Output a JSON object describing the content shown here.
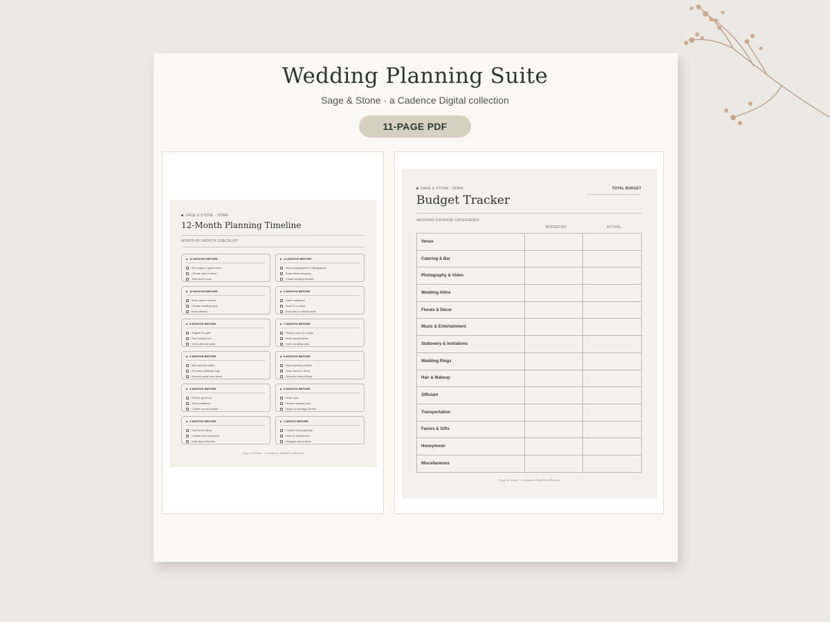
{
  "header": {
    "title": "Wedding Planning Suite",
    "subtitle": "Sage & Stone · a Cadence Digital collection",
    "badge": "11-PAGE PDF"
  },
  "timeline_page": {
    "breadcrumb": "SAGE & STONE  ·  HOME",
    "title": "12-Month Planning Timeline",
    "section_label": "MONTH-BY-MONTH CHECKLIST",
    "months": [
      {
        "label": "12 MONTHS BEFORE",
        "items": [
          "Set budget & guest count",
          "Choose date & venue",
          "Start venue tours"
        ]
      },
      {
        "label": "11 MONTHS BEFORE",
        "items": [
          "Book photographer & videographer",
          "Begin dress shopping",
          "Create wedding website"
        ]
      },
      {
        "label": "10 MONTHS BEFORE",
        "items": [
          "Book caterer & florist",
          "Choose wedding party",
          "Book officiant"
        ]
      },
      {
        "label": "9 MONTHS BEFORE",
        "items": [
          "Order invitations",
          "Book DJ or band",
          "Book hair & makeup artist"
        ]
      },
      {
        "label": "8 MONTHS BEFORE",
        "items": [
          "Register for gifts",
          "Plan honeymoon",
          "Order attire for party"
        ]
      },
      {
        "label": "7 MONTHS BEFORE",
        "items": [
          "Finalize menu & rentals",
          "Book transportation",
          "Order wedding cake"
        ]
      },
      {
        "label": "6 MONTHS BEFORE",
        "items": [
          "Mail save-the-dates",
          "Purchase wedding rings",
          "Reserve guest room block"
        ]
      },
      {
        "label": "5 MONTHS BEFORE",
        "items": [
          "Plan ceremony details",
          "Order favors & décor",
          "Schedule dress fittings"
        ]
      },
      {
        "label": "4 MONTHS BEFORE",
        "items": [
          "Finalize guest list",
          "Send invitations",
          "Confirm vendor details"
        ]
      },
      {
        "label": "3 MONTHS BEFORE",
        "items": [
          "Write vows",
          "Finalize seating chart",
          "Apply for marriage license"
        ]
      },
      {
        "label": "2 MONTHS BEFORE",
        "items": [
          "Final dress fitting",
          "Confirm final headcount",
          "Draft day-of timeline"
        ]
      },
      {
        "label": "1 MONTH BEFORE",
        "items": [
          "Confirm final payments",
          "Pack for honeymoon",
          "Delegate day-of tasks"
        ]
      }
    ],
    "footer": "Sage & Stone  ·  a Cadence Digital collection"
  },
  "budget_page": {
    "breadcrumb": "SAGE & STONE  ·  HOME",
    "total_label": "TOTAL BUDGET",
    "title": "Budget Tracker",
    "section_label": "WEDDING EXPENSE CATEGORIES",
    "col_budgeted": "BUDGETED",
    "col_actual": "ACTUAL",
    "categories": [
      "Venue",
      "Catering & Bar",
      "Photography & Video",
      "Wedding Attire",
      "Florals & Décor",
      "Music & Entertainment",
      "Stationery & Invitations",
      "Wedding Rings",
      "Hair & Makeup",
      "Officiant",
      "Transportation",
      "Favors & Gifts",
      "Honeymoon",
      "Miscellaneous"
    ],
    "footer": "Sage & Stone  ·  a Cadence Digital collection"
  }
}
